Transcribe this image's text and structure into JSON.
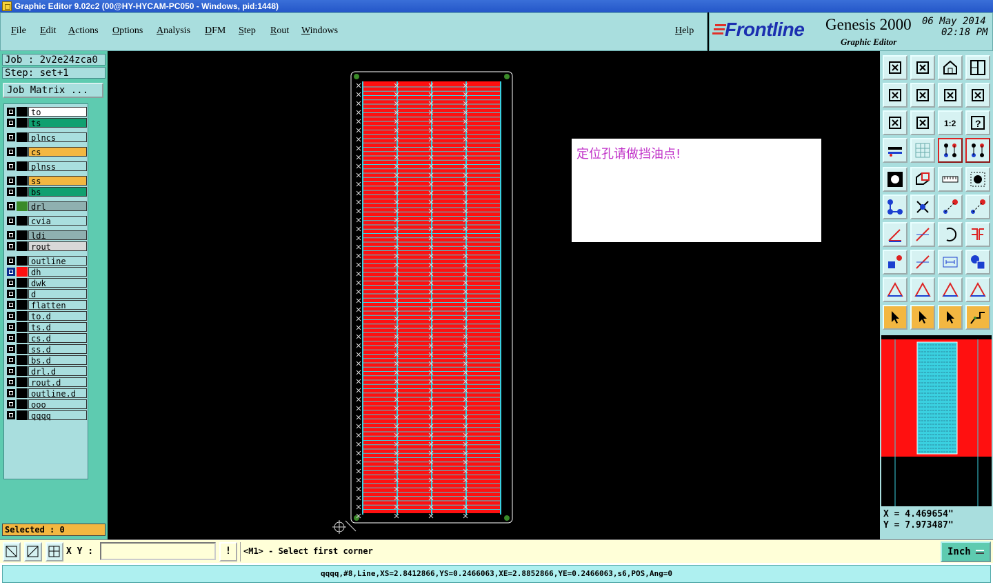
{
  "window": {
    "title": "Graphic Editor 9.02c2 (00@HY-HYCAM-PC050 - Windows, pid:1448)"
  },
  "menu": {
    "items": [
      "File",
      "Edit",
      "Actions",
      "Options",
      "Analysis",
      "DFM",
      "Step",
      "Rout",
      "Windows"
    ],
    "help": "Help"
  },
  "brand": {
    "logo_prefix": "Fr",
    "logo_rest": "ontline",
    "product": "Genesis 2000",
    "subtitle": "Graphic Editor",
    "date": "06 May 2014",
    "time": "02:18 PM"
  },
  "job": {
    "job_label": "Job : 2v2e24zca0",
    "step_label": "Step: set+1",
    "matrix_button": "Job Matrix ..."
  },
  "layers": [
    {
      "name": "to",
      "bg": "#ffffff",
      "swatch": "#ffffff"
    },
    {
      "name": "ts",
      "bg": "#10a070",
      "swatch": "#10a070"
    },
    {
      "name": "plncs",
      "bg": "#a9dede",
      "swatch": "#a9dede"
    },
    {
      "name": "cs",
      "bg": "#f3b741",
      "swatch": "#f3b741"
    },
    {
      "name": "plnss",
      "bg": "#a9dede",
      "swatch": "#a9dede"
    },
    {
      "name": "ss",
      "bg": "#f3b741",
      "swatch": "#f3b741"
    },
    {
      "name": "bs",
      "bg": "#10a070",
      "swatch": "#10a070"
    },
    {
      "name": "drl",
      "bg": "#8fb0b0",
      "swatch": "#3a8a28"
    },
    {
      "name": "cvia",
      "bg": "#a9dede",
      "swatch": "#a9dede"
    },
    {
      "name": "ldi",
      "bg": "#8fb0b0",
      "swatch": "#8fb0b0"
    },
    {
      "name": "rout",
      "bg": "#d8d8d8",
      "swatch": "#d8d8d8"
    },
    {
      "name": "outline",
      "bg": "#a9dede",
      "swatch": "#a9dede"
    },
    {
      "name": "dh",
      "bg": "#a9dede",
      "swatch": "#ff1010"
    },
    {
      "name": "dwk",
      "bg": "#a9dede",
      "swatch": "#a9dede"
    },
    {
      "name": "d",
      "bg": "#a9dede",
      "swatch": "#a9dede"
    },
    {
      "name": "flatten",
      "bg": "#a9dede",
      "swatch": "#a9dede"
    },
    {
      "name": "to.d",
      "bg": "#a9dede",
      "swatch": "#a9dede"
    },
    {
      "name": "ts.d",
      "bg": "#a9dede",
      "swatch": "#a9dede"
    },
    {
      "name": "cs.d",
      "bg": "#a9dede",
      "swatch": "#a9dede"
    },
    {
      "name": "ss.d",
      "bg": "#a9dede",
      "swatch": "#a9dede"
    },
    {
      "name": "bs.d",
      "bg": "#a9dede",
      "swatch": "#a9dede"
    },
    {
      "name": "drl.d",
      "bg": "#a9dede",
      "swatch": "#a9dede"
    },
    {
      "name": "rout.d",
      "bg": "#a9dede",
      "swatch": "#a9dede"
    },
    {
      "name": "outline.d",
      "bg": "#a9dede",
      "swatch": "#a9dede"
    },
    {
      "name": "ooo",
      "bg": "#a9dede",
      "swatch": "#a9dede"
    },
    {
      "name": "qqqq",
      "bg": "#a9dede",
      "swatch": "#a9dede"
    }
  ],
  "selected": "Selected : 0",
  "note": "定位孔请做挡油点!",
  "toolbar_icons": [
    "layer-up-icon",
    "layer-down-icon",
    "home-icon",
    "window-split-icon",
    "move-left-icon",
    "move-right-icon",
    "mirror-icon",
    "flip-icon",
    "zoom-fit-icon",
    "zoom-center-icon",
    "scale-1-2-icon",
    "help-icon",
    "drill-tool-icon",
    "grid-icon",
    "snap-red-icon",
    "snap-red-active-icon",
    "pad-icon",
    "polygon-icon",
    "ruler-icon",
    "circle-dot-icon",
    "net-nodes-icon",
    "cross-x-icon",
    "connect-red-icon",
    "connect-blue-icon",
    "angle-icon",
    "line-icon",
    "arc-icon",
    "fence-icon",
    "select-pad-icon",
    "line-red-icon",
    "measure-icon",
    "group-icon",
    "triangle-small-icon",
    "triangle-a-icon",
    "triangle-b-icon",
    "triangle-c-icon",
    "pointer-icon",
    "pointer-box-icon",
    "pointer-circle-icon",
    "route-icon"
  ],
  "coords": {
    "x": "X = 4.469654\"",
    "y": "Y = 7.973487\""
  },
  "cmd": {
    "xy_label": "X Y :",
    "xy_value": "",
    "bang": "!",
    "prompt": "<M1> - Select first corner",
    "unit": "Inch"
  },
  "status": "qqqq,#8,Line,XS=2.8412866,YS=0.2466063,XE=2.8852866,YE=0.2466063,s6,POS,Ang=0",
  "colors": {
    "menu_bg": "#a9dede",
    "panel_bg": "#5ecbb0",
    "copper": "#ff1010",
    "trace": "#3ad0e0"
  }
}
